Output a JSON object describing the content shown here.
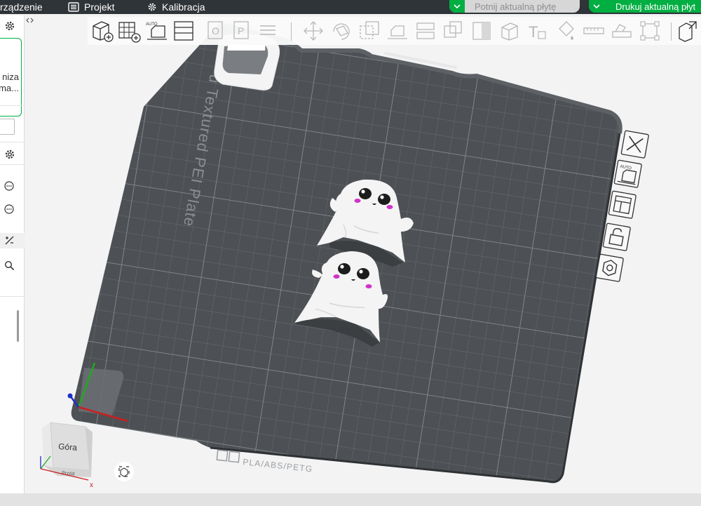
{
  "menu": {
    "device_label": "rządzenie",
    "project_label": "Projekt",
    "calibration_label": "Kalibracja"
  },
  "actions": {
    "slice_label": "Potnij aktualną płytę",
    "print_label": "Drukuj aktualną płyt"
  },
  "sidebar": {
    "card_line1": "niza",
    "card_line2": "ma..."
  },
  "plate": {
    "name_label": "u Textured PEI Plate",
    "material_label": "PLA/ABS/PETG"
  },
  "nav_cube": {
    "face_label": "Góra",
    "bottom_label": "Przód",
    "axis_x": "x"
  },
  "colors": {
    "accent": "#00ae42",
    "plate": "#4d5054",
    "topbar": "#2f3438"
  }
}
